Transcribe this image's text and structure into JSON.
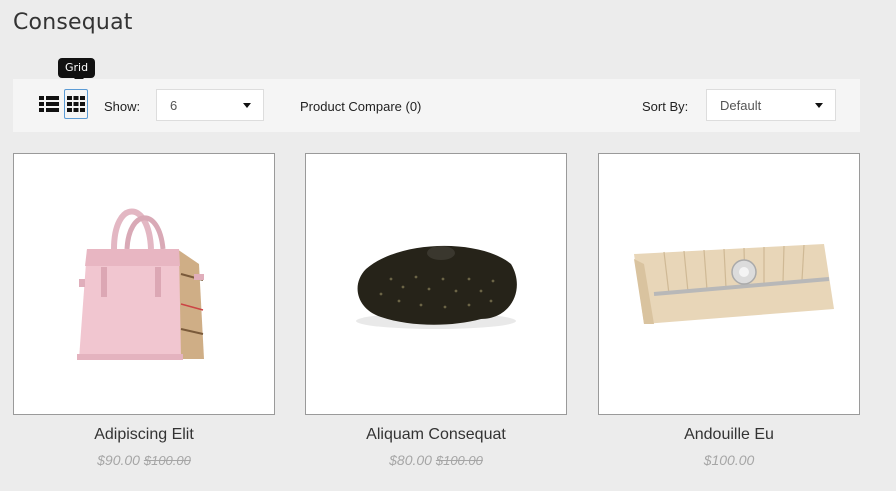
{
  "page": {
    "title": "Consequat"
  },
  "tooltip": {
    "text": "Grid"
  },
  "toolbar": {
    "list_icon": "list-view-icon",
    "grid_icon": "grid-view-icon",
    "show_label": "Show:",
    "show_value": "6",
    "compare_label": "Product Compare (0)",
    "sort_label": "Sort By:",
    "sort_value": "Default"
  },
  "products": [
    {
      "name": "Adipiscing Elit",
      "price": "$90.00",
      "old_price": "$100.00",
      "image": "pink-handbag"
    },
    {
      "name": "Aliquam Consequat",
      "price": "$80.00",
      "old_price": "$100.00",
      "image": "black-clutch"
    },
    {
      "name": "Andouille Eu",
      "price": "$100.00",
      "old_price": "",
      "image": "beige-clutch"
    }
  ]
}
